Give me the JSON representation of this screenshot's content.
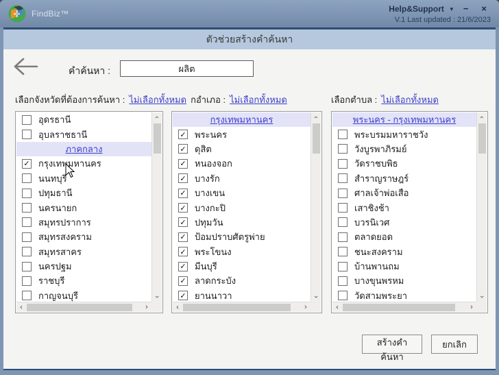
{
  "window": {
    "title": "FindBiz™",
    "help_label": "Help&Support",
    "version": "V.1 Last updated : 21/6/2023"
  },
  "dialog": {
    "title": "ตัวช่วยสร้างคำค้นหา",
    "search_label": "คำค้นหา :",
    "search_value": "ผลิต",
    "province_label": "เลือกจังหวัดที่ต้องการค้นหา :",
    "district_label": "กอำเภอ :",
    "subdistrict_label": "เลือกตำบล :",
    "deselect_all": "ไม่เลือกทั้งหมด",
    "create_button": "สร้างคำค้นหา",
    "cancel_button": "ยกเลิก"
  },
  "icons": {
    "check": "✓",
    "chevron": "›",
    "dropdown_arrow": "▼",
    "minimize": "−",
    "close": "×"
  },
  "colors": {
    "titlebar": "#7e95b4",
    "dialog_header": "#b5c8dd",
    "link": "#3c3ccc",
    "section_header_bg": "#e3e3f8",
    "navy_line": "#2e4d72"
  },
  "lists": {
    "provinces": {
      "items": [
        {
          "label": "อุดรธานี",
          "checked": false
        },
        {
          "label": "อุบลราชธานี",
          "checked": false
        },
        {
          "label": "ภาคกลาง",
          "type": "header"
        },
        {
          "label": "กรุงเทพมหานคร",
          "checked": true
        },
        {
          "label": "นนทบุรี",
          "checked": false
        },
        {
          "label": "ปทุมธานี",
          "checked": false
        },
        {
          "label": "นครนายก",
          "checked": false
        },
        {
          "label": "สมุทรปราการ",
          "checked": false
        },
        {
          "label": "สมุทรสงคราม",
          "checked": false
        },
        {
          "label": "สมุทรสาคร",
          "checked": false
        },
        {
          "label": "นครปฐม",
          "checked": false
        },
        {
          "label": "ราชบุรี",
          "checked": false
        },
        {
          "label": "กาญจนบุรี",
          "checked": false
        }
      ]
    },
    "districts": {
      "items": [
        {
          "label": "กรุงเทพมหานคร",
          "type": "header"
        },
        {
          "label": "พระนคร",
          "checked": true
        },
        {
          "label": "ดุสิต",
          "checked": true
        },
        {
          "label": "หนองจอก",
          "checked": true
        },
        {
          "label": "บางรัก",
          "checked": true
        },
        {
          "label": "บางเขน",
          "checked": true
        },
        {
          "label": "บางกะปิ",
          "checked": true
        },
        {
          "label": "ปทุมวัน",
          "checked": true
        },
        {
          "label": "ป้อมปราบศัตรูพ่าย",
          "checked": true
        },
        {
          "label": "พระโขนง",
          "checked": true
        },
        {
          "label": "มีนบุรี",
          "checked": true
        },
        {
          "label": "ลาดกระบัง",
          "checked": true
        },
        {
          "label": "ยานนาวา",
          "checked": true
        }
      ]
    },
    "subdistricts": {
      "items": [
        {
          "label": "พระนคร - กรุงเทพมหานคร",
          "type": "header"
        },
        {
          "label": "พระบรมมหาราชวัง",
          "checked": false
        },
        {
          "label": "วังบูรพาภิรมย์",
          "checked": false
        },
        {
          "label": "วัดราชบพิธ",
          "checked": false
        },
        {
          "label": "สำราญราษฎร์",
          "checked": false
        },
        {
          "label": "ศาลเจ้าพ่อเสือ",
          "checked": false
        },
        {
          "label": "เสาชิงช้า",
          "checked": false
        },
        {
          "label": "บวรนิเวศ",
          "checked": false
        },
        {
          "label": "ตลาดยอด",
          "checked": false
        },
        {
          "label": "ชนะสงคราม",
          "checked": false
        },
        {
          "label": "บ้านพานถม",
          "checked": false
        },
        {
          "label": "บางขุนพรหม",
          "checked": false
        },
        {
          "label": "วัดสามพระยา",
          "checked": false
        }
      ]
    }
  }
}
